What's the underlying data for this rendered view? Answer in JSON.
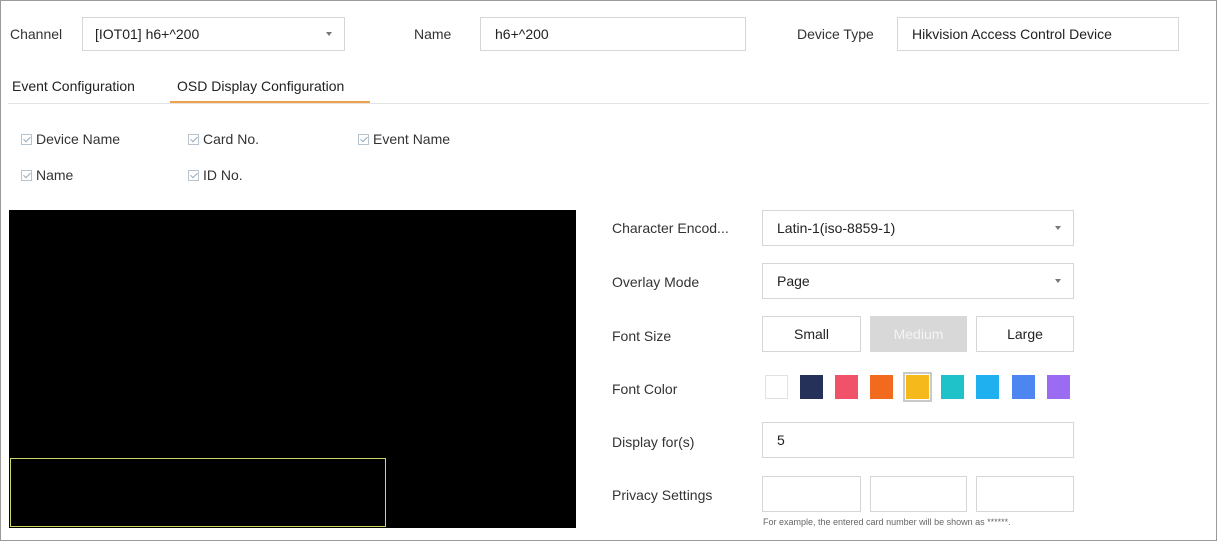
{
  "header": {
    "channel_label": "Channel",
    "channel_value": "[IOT01] h6+^200",
    "name_label": "Name",
    "name_value": "h6+^200",
    "device_type_label": "Device Type",
    "device_type_value": "Hikvision Access Control Device"
  },
  "tabs": [
    {
      "label": "Event Configuration",
      "active": false
    },
    {
      "label": "OSD Display Configuration",
      "active": true
    }
  ],
  "checkboxes": [
    {
      "label": "Device Name",
      "checked": true
    },
    {
      "label": "Card No.",
      "checked": true
    },
    {
      "label": "Event Name",
      "checked": true
    },
    {
      "label": "Name",
      "checked": true
    },
    {
      "label": "ID No.",
      "checked": true
    }
  ],
  "settings": {
    "char_encoding_label": "Character Encod...",
    "char_encoding_value": "Latin-1(iso-8859-1)",
    "overlay_mode_label": "Overlay Mode",
    "overlay_mode_value": "Page",
    "font_size_label": "Font Size",
    "font_sizes": [
      "Small",
      "Medium",
      "Large"
    ],
    "font_size_selected": "Medium",
    "font_color_label": "Font Color",
    "font_colors": [
      "#ffffff",
      "#26315a",
      "#f0526a",
      "#f26a1e",
      "#f5b91b",
      "#1fc2c8",
      "#1fb0f0",
      "#4d86f0",
      "#9b6cf2"
    ],
    "font_color_selected": "#f5b91b",
    "display_for_label": "Display for(s)",
    "display_for_value": "5",
    "privacy_label": "Privacy Settings",
    "privacy_hint": "For example, the entered card number will be shown as ******."
  },
  "icons": {
    "dropdown": "chevron-down-icon",
    "checkbox": "checkbox-checked-icon"
  }
}
